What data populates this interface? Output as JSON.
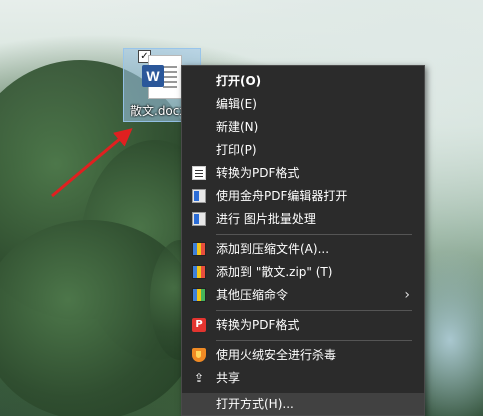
{
  "desktop": {
    "file": {
      "name": "散文.docx",
      "icon": "word-document-icon",
      "selected": true
    }
  },
  "context_menu": {
    "items": [
      {
        "label": "打开(O)",
        "bold": true,
        "icon": ""
      },
      {
        "label": "编辑(E)",
        "icon": ""
      },
      {
        "label": "新建(N)",
        "icon": ""
      },
      {
        "label": "打印(P)",
        "icon": ""
      },
      {
        "label": "转换为PDF格式",
        "icon": "pdf-document-icon"
      },
      {
        "label": "使用金舟PDF编辑器打开",
        "icon": "pdf-editor-icon"
      },
      {
        "label": "进行 图片批量处理",
        "icon": "image-batch-icon"
      },
      {
        "label": "添加到压缩文件(A)...",
        "icon": "archive-icon"
      },
      {
        "label": "添加到 \"散文.zip\" (T)",
        "icon": "archive-icon"
      },
      {
        "label": "其他压缩命令",
        "icon": "archive-icon",
        "submenu": true,
        "chevron": "›"
      },
      {
        "label": "转换为PDF格式",
        "icon": "pdf-red-icon",
        "icon_text": "P"
      },
      {
        "label": "使用火绒安全进行杀毒",
        "icon": "shield-icon"
      },
      {
        "label": "共享",
        "icon": "share-icon",
        "icon_text": "⇪"
      },
      {
        "label": "打开方式(H)...",
        "icon": "",
        "highlighted": true
      }
    ]
  },
  "colors": {
    "menu_bg": "#2b2b2b",
    "menu_highlight": "#414141",
    "arrow": "#e02020",
    "word_blue": "#2b579a"
  }
}
